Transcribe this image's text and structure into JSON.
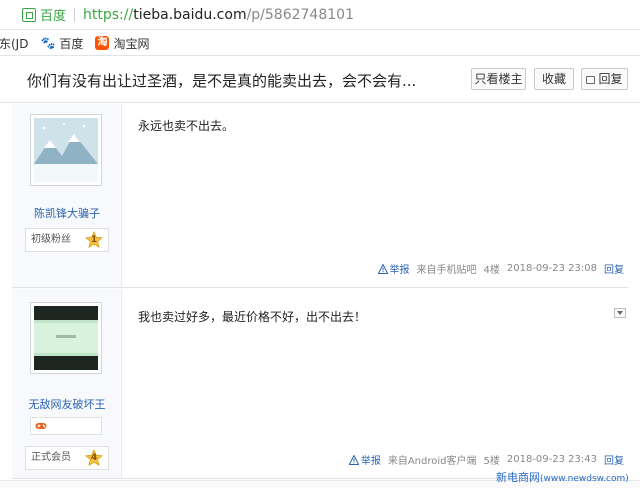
{
  "browser": {
    "site_name": "百度",
    "url_protocol": "https://",
    "url_host": "tieba.baidu.com",
    "url_path": "/p/5862748101",
    "bookmarks": [
      {
        "label": "东(JD",
        "icon": "none"
      },
      {
        "label": "百度",
        "icon": "baidu-paw-icon"
      },
      {
        "label": "淘宝网",
        "icon": "taobao-icon"
      }
    ]
  },
  "thread": {
    "title": "你们有没有出让过圣酒，是不是真的能卖出去，会不会有...",
    "buttons": {
      "only_op": "只看楼主",
      "favorite": "收藏",
      "reply": "回复"
    }
  },
  "posts": [
    {
      "username": "陈凯锋大骗子",
      "level_title": "初级粉丝",
      "level": "1",
      "content": "永远也卖不出去。",
      "report": "举报",
      "source": "来自手机贴吧",
      "floor": "4楼",
      "time": "2018-09-23 23:08",
      "reply": "回复"
    },
    {
      "username": "无敌网友破坏王",
      "level_title": "正式会员",
      "level": "4",
      "content": "我也卖过好多，最近价格不好，出不出去！",
      "report": "举报",
      "source": "来自Android客户端",
      "floor": "5楼",
      "time": "2018-09-23 23:43",
      "reply": "回复"
    }
  ],
  "watermark": {
    "text": "新电商网",
    "url": "(www.newdsw.com)"
  },
  "colors": {
    "link": "#2d64b3",
    "secure_green": "#3aa745",
    "level_star": "#f5c542"
  }
}
